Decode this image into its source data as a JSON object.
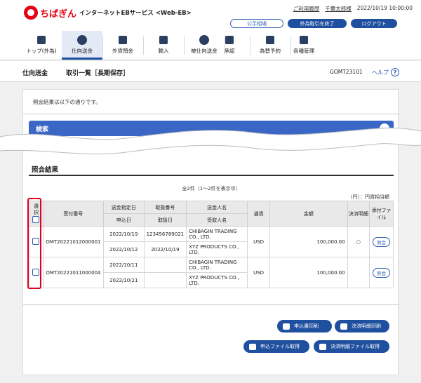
{
  "header": {
    "logo_text": "ちばぎん",
    "service_name": "インターネットEBサービス <Web-EB>",
    "usage_link": "ご利用履歴",
    "user_name": "千葉太郎様",
    "datetime": "2022/10/19 10:00:00",
    "rate_button": "公示相場",
    "end_fx_button": "外為取引を終了",
    "logout_button": "ログアウト"
  },
  "nav": {
    "items": [
      {
        "label": "トップ(外為)",
        "icon": "home-icon"
      },
      {
        "label": "仕向送金",
        "icon": "remittance-icon"
      },
      {
        "label": "外貨預金",
        "icon": "deposit-icon"
      },
      {
        "label": "輸入",
        "icon": "import-icon"
      },
      {
        "label": "被仕向送金",
        "icon": "inbound-icon"
      },
      {
        "label": "承認",
        "icon": "approve-icon"
      },
      {
        "label": "為替予約",
        "icon": "fx-contract-icon"
      },
      {
        "label": "各種管理",
        "icon": "manage-icon"
      }
    ]
  },
  "subheader": {
    "breadcrumb": "仕向送金",
    "page_title": "取引一覧［長期保存］",
    "screen_code": "GOMT23101",
    "help_label": "ヘルプ"
  },
  "main": {
    "notice": "照会結果は以下の通りです。",
    "search_title": "検索",
    "results_title": "照会結果",
    "count_text": "全2件（1～2件を表示中）",
    "unit_text": "（円）：円貨相当額",
    "columns": {
      "select": "選択",
      "receipt_no": "受付番号",
      "designated_date": "送金指定日",
      "apply_date": "申込日",
      "handling_no": "取扱番号",
      "handling_date": "取扱日",
      "remitter": "送金人名",
      "beneficiary": "受取人名",
      "currency": "通貨",
      "amount": "金額",
      "settlement": "決済明細",
      "attach": "添付ファイル"
    },
    "rows": [
      {
        "receipt_no": "OMT20221012000001",
        "designated_date": "2022/10/19",
        "apply_date": "2022/10/12",
        "handling_no": "123456789021",
        "handling_date": "2022/10/19",
        "remitter": "CHIBAGIN TRADING CO., LTD.",
        "beneficiary": "XYZ PRODUCTS CO., LTD.",
        "currency": "USD",
        "amount": "100,000.00",
        "settlement": "○",
        "attach": "照会"
      },
      {
        "receipt_no": "OMT20221011000004",
        "designated_date": "2022/10/11",
        "apply_date": "2022/10/21",
        "handling_no": "",
        "handling_date": "",
        "remitter": "CHIBAGIN TRADING CO., LTD.",
        "beneficiary": "XYZ PRODUCTS CO., LTD.",
        "currency": "USD",
        "amount": "100,000.00",
        "settlement": "",
        "attach": "照会"
      }
    ],
    "buttons": {
      "print_application": "申込書印刷",
      "print_settlement": "決済明細印刷",
      "get_application_file": "申込ファイル取得",
      "get_settlement_file": "決済明細ファイル取得"
    }
  }
}
